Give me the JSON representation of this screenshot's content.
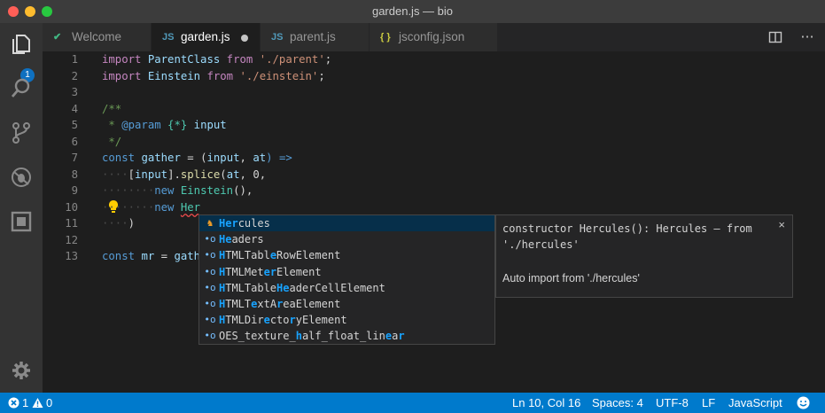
{
  "window": {
    "title": "garden.js — bio"
  },
  "activity_bar": {
    "explorer_badge": "1"
  },
  "tabs": [
    {
      "icon": "JS-vue",
      "icon_text": "✔",
      "label": "Welcome"
    },
    {
      "icon": "js",
      "icon_text": "JS",
      "label": "garden.js",
      "dirty": true
    },
    {
      "icon": "js",
      "icon_text": "JS",
      "label": "parent.js"
    },
    {
      "icon": "json",
      "icon_text": "{ }",
      "label": "jsconfig.json"
    }
  ],
  "tab_actions": {
    "split": "split-editor-icon",
    "more": "···"
  },
  "editor": {
    "line_numbers": [
      "1",
      "2",
      "3",
      "4",
      "5",
      "6",
      "7",
      "8",
      "9",
      "10",
      "11",
      "12",
      "13"
    ],
    "lines": {
      "l1": {
        "k": "import",
        "n": "ParentClass",
        "f": "from",
        "s": "'./parent'",
        "e": ";"
      },
      "l2": {
        "k": "import",
        "n": "Einstein",
        "f": "from",
        "s": "'./einstein'",
        "e": ";"
      },
      "l4": "/**",
      "l5a": " * ",
      "l5b": "@param",
      "l5c": "{*}",
      "l5d": "input",
      "l6": " */",
      "l7": {
        "k": "const",
        "n": "gather",
        "eq": " = (",
        "p1": "input",
        "c": ", ",
        "p2": "at",
        "arrow": ") =>"
      },
      "l8": {
        "ws": "····",
        "a": "[",
        "v": "input",
        "b": "].",
        "m": "splice",
        "c": "(",
        "v2": "at",
        "d": ", 0,"
      },
      "l9": {
        "ws": "········",
        "k": "new",
        "t": "Einstein",
        "e": "(),"
      },
      "l10": {
        "ws": "········",
        "k": "new",
        "t": "Her"
      },
      "l11": {
        "ws": "····",
        "e": ")"
      },
      "l13": {
        "k": "const",
        "n": "mr",
        "eq": " = ",
        "f": "gath"
      }
    }
  },
  "suggestions": [
    {
      "icon": "class-icon",
      "glyph": "♞",
      "parts": [
        [
          "Her",
          true
        ],
        [
          "cules",
          false
        ]
      ],
      "selected": true
    },
    {
      "icon": "variable-icon",
      "glyph": "•o",
      "parts": [
        [
          "He",
          true
        ],
        [
          "aders",
          false
        ]
      ]
    },
    {
      "icon": "variable-icon",
      "glyph": "•o",
      "parts": [
        [
          "H",
          true
        ],
        [
          "TMLTabl",
          false
        ],
        [
          "e",
          true
        ],
        [
          "RowElement",
          false
        ]
      ]
    },
    {
      "icon": "variable-icon",
      "glyph": "•o",
      "parts": [
        [
          "H",
          true
        ],
        [
          "TMLMet",
          false
        ],
        [
          "er",
          true
        ],
        [
          "Element",
          false
        ]
      ]
    },
    {
      "icon": "variable-icon",
      "glyph": "•o",
      "parts": [
        [
          "H",
          true
        ],
        [
          "TMLTable",
          false
        ],
        [
          "He",
          true
        ],
        [
          "aderCellElement",
          false
        ]
      ]
    },
    {
      "icon": "variable-icon",
      "glyph": "•o",
      "parts": [
        [
          "H",
          true
        ],
        [
          "TMLT",
          false
        ],
        [
          "e",
          true
        ],
        [
          "xtA",
          false
        ],
        [
          "r",
          true
        ],
        [
          "eaElement",
          false
        ]
      ]
    },
    {
      "icon": "variable-icon",
      "glyph": "•o",
      "parts": [
        [
          "H",
          true
        ],
        [
          "TMLDir",
          false
        ],
        [
          "e",
          true
        ],
        [
          "cto",
          false
        ],
        [
          "r",
          true
        ],
        [
          "yElement",
          false
        ]
      ]
    },
    {
      "icon": "variable-icon",
      "glyph": "•o",
      "parts": [
        [
          "OES_texture_",
          false
        ],
        [
          "h",
          true
        ],
        [
          "alf_float_lin",
          false
        ],
        [
          "e",
          true
        ],
        [
          "a",
          false
        ],
        [
          "r",
          true
        ]
      ]
    }
  ],
  "details": {
    "signature_line1": "constructor Hercules(): Hercules – from",
    "signature_line2": "'./hercules'",
    "doc": "Auto import from './hercules'",
    "close": "×"
  },
  "status_bar": {
    "errors": "1",
    "warnings": "0",
    "position": "Ln 10, Col 16",
    "spaces": "Spaces: 4",
    "encoding": "UTF-8",
    "eol": "LF",
    "language": "JavaScript"
  },
  "colors": {
    "accent": "#007acc",
    "editor_bg": "#1e1e1e",
    "suggest_selected": "#062f4a",
    "match_highlight": "#18a3ff"
  }
}
